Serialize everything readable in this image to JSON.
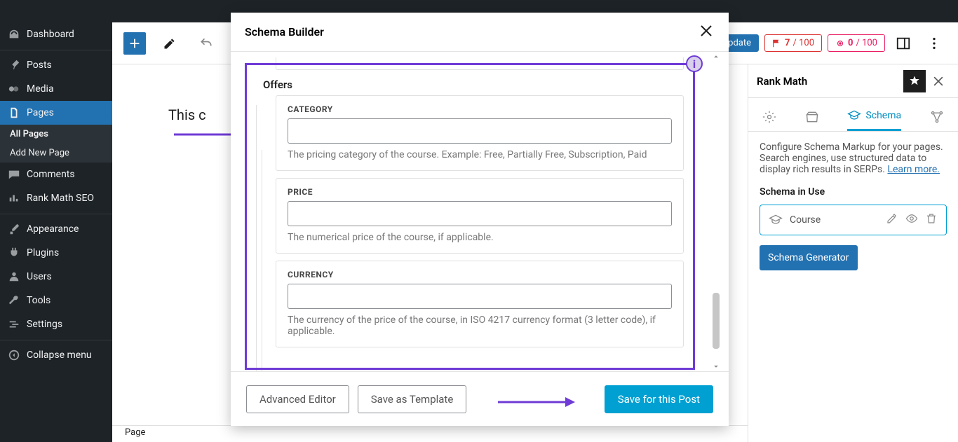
{
  "sidebar": {
    "items": [
      {
        "label": "Dashboard"
      },
      {
        "label": "Posts"
      },
      {
        "label": "Media"
      },
      {
        "label": "Pages"
      },
      {
        "label": "Comments"
      },
      {
        "label": "Rank Math SEO"
      },
      {
        "label": "Appearance"
      },
      {
        "label": "Plugins"
      },
      {
        "label": "Users"
      },
      {
        "label": "Tools"
      },
      {
        "label": "Settings"
      },
      {
        "label": "Collapse menu"
      }
    ],
    "subitems": [
      {
        "label": "All Pages"
      },
      {
        "label": "Add New Page"
      }
    ]
  },
  "editor": {
    "content_preview": "This c",
    "update_label": "pdate",
    "score1_prefix": "7",
    "score1_suffix": " / 100",
    "score2_prefix": "0",
    "score2_suffix": " / 100",
    "footer_label": "Page"
  },
  "rightpanel": {
    "title": "Rank Math",
    "tab_label": "Schema",
    "desc_a": "Configure Schema Markup for your pages. Search engines, use structured data to display rich results in SERPs. ",
    "learn_more": "Learn more.",
    "in_use_title": "Schema in Use",
    "schema_name": "Course",
    "generator_btn": "Schema Generator"
  },
  "modal": {
    "title": "Schema Builder",
    "section_title": "Offers",
    "info_badge": "i",
    "fields": {
      "category": {
        "label": "CATEGORY",
        "help": "The pricing category of the course. Example: Free, Partially Free, Subscription, Paid"
      },
      "price": {
        "label": "PRICE",
        "help": "The numerical price of the course, if applicable."
      },
      "currency": {
        "label": "CURRENCY",
        "help": "The currency of the price of the course, in ISO 4217 currency format (3 letter code), if applicable."
      }
    },
    "footer": {
      "advanced": "Advanced Editor",
      "save_template": "Save as Template",
      "save_post": "Save for this Post"
    }
  }
}
